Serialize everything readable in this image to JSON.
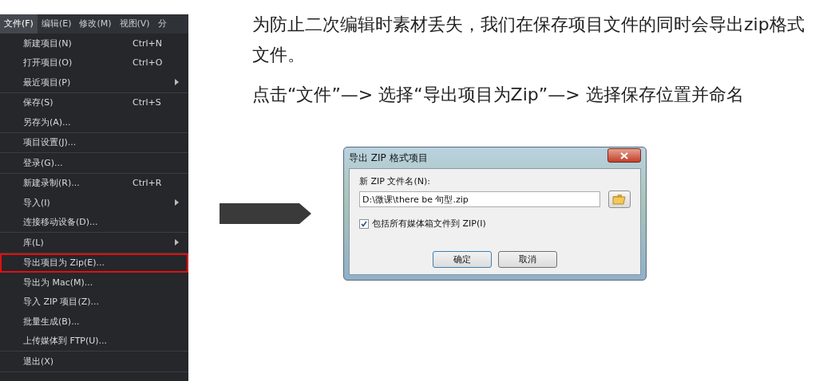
{
  "menubar": [
    {
      "label": "文件(F)",
      "selected": true
    },
    {
      "label": "编辑(E)",
      "selected": false
    },
    {
      "label": "修改(M)",
      "selected": false
    },
    {
      "label": "视图(V)",
      "selected": false
    },
    {
      "label": "分",
      "selected": false
    }
  ],
  "menu_groups": [
    [
      {
        "label": "新建项目(N)",
        "shortcut": "Ctrl+N",
        "submenu": false,
        "highlighted": false
      },
      {
        "label": "打开项目(O)",
        "shortcut": "Ctrl+O",
        "submenu": false,
        "highlighted": false
      },
      {
        "label": "最近项目(P)",
        "submenu": true,
        "highlighted": false
      }
    ],
    [
      {
        "label": "保存(S)",
        "shortcut": "Ctrl+S",
        "submenu": false,
        "highlighted": false
      },
      {
        "label": "另存为(A)...",
        "submenu": false,
        "highlighted": false
      }
    ],
    [
      {
        "label": "项目设置(J)...",
        "submenu": false,
        "highlighted": false
      }
    ],
    [
      {
        "label": "登录(G)...",
        "submenu": false,
        "highlighted": false
      }
    ],
    [
      {
        "label": "新建录制(R)...",
        "shortcut": "Ctrl+R",
        "submenu": false,
        "highlighted": false
      },
      {
        "label": "导入(I)",
        "submenu": true,
        "highlighted": false
      },
      {
        "label": "连接移动设备(D)...",
        "submenu": false,
        "highlighted": false
      }
    ],
    [
      {
        "label": "库(L)",
        "submenu": true,
        "highlighted": false
      }
    ],
    [
      {
        "label": "导出项目为 Zip(E)...",
        "submenu": false,
        "highlighted": true
      },
      {
        "label": "导出为 Mac(M)...",
        "submenu": false,
        "highlighted": false
      },
      {
        "label": "导入 ZIP 项目(Z)...",
        "submenu": false,
        "highlighted": false
      },
      {
        "label": "批量生成(B)...",
        "submenu": false,
        "highlighted": false
      },
      {
        "label": "上传媒体到 FTP(U)...",
        "submenu": false,
        "highlighted": false
      }
    ],
    [
      {
        "label": "退出(X)",
        "submenu": false,
        "highlighted": false
      }
    ]
  ],
  "paragraphs": [
    "为防止二次编辑时素材丢失，我们在保存项目文件的同时会导出zip格式文件。",
    "点击“文件”—> 选择“导出项目为Zip”—> 选择保存位置并命名"
  ],
  "dialog": {
    "title": "导出 ZIP 格式项目",
    "field_label": "新 ZIP 文件名(N):",
    "field_value": "D:\\微课\\there be 句型.zip",
    "checkbox": {
      "label": "包括所有媒体箱文件到 ZIP(I)",
      "checked": true
    },
    "buttons": [
      {
        "label": "确定",
        "default": true
      },
      {
        "label": "取消",
        "default": false
      }
    ]
  }
}
